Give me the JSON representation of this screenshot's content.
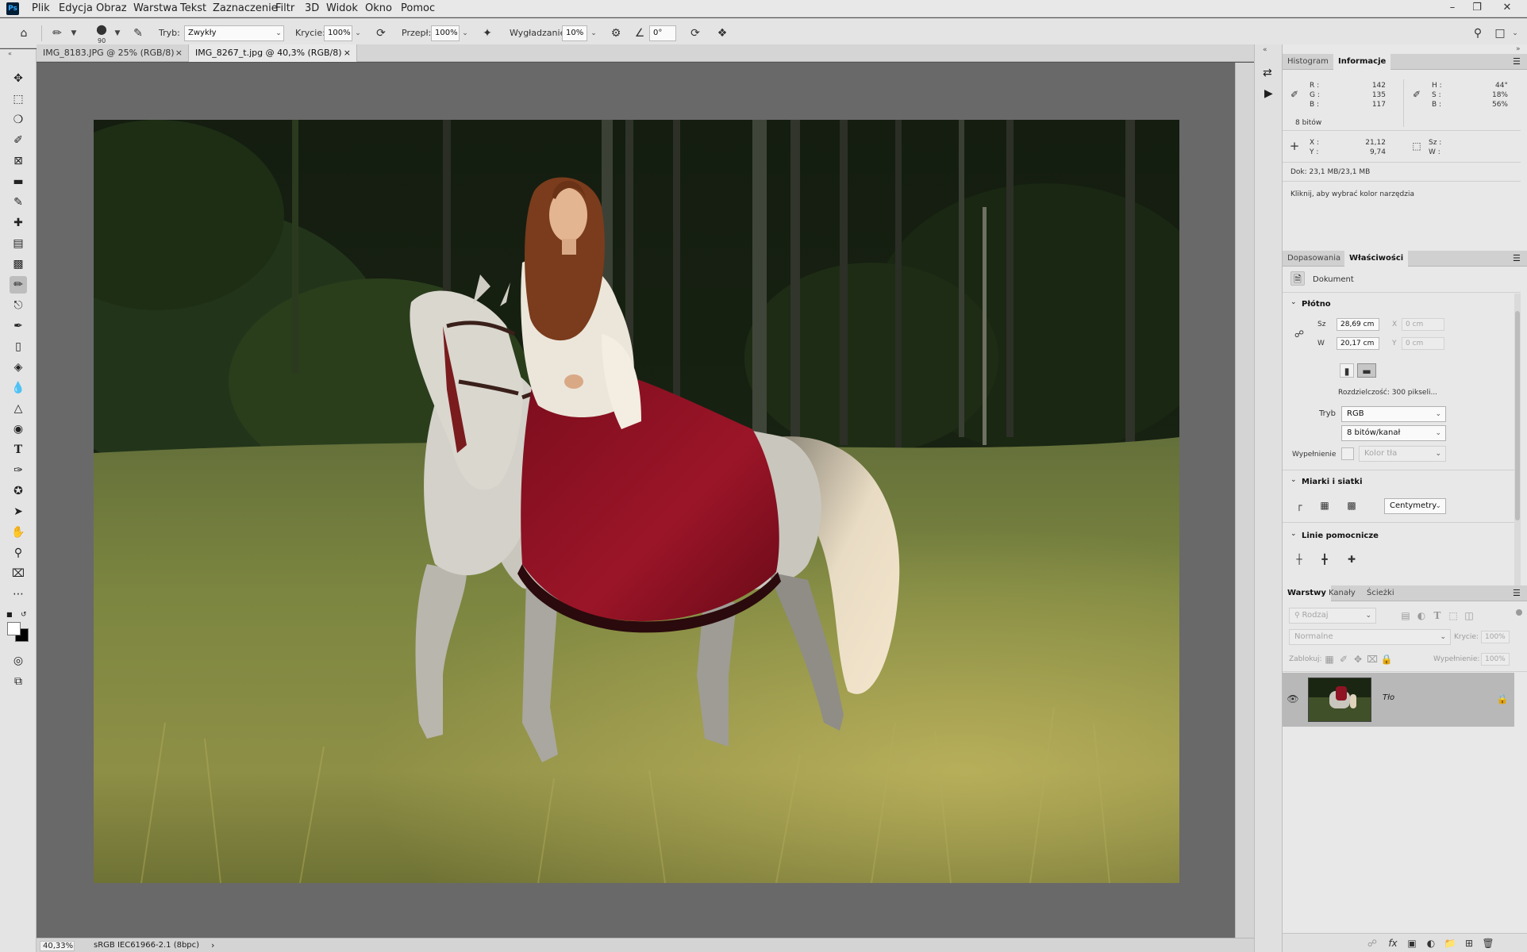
{
  "app": {
    "logo": "Ps"
  },
  "menu": [
    "Plik",
    "Edycja",
    "Obraz",
    "Warstwa",
    "Tekst",
    "Zaznaczenie",
    "Filtr",
    "3D",
    "Widok",
    "Okno",
    "Pomoc"
  ],
  "window_controls": {
    "minimize": "–",
    "restore": "❐",
    "close": "✕"
  },
  "options": {
    "brush_size": "90",
    "mode_label": "Tryb:",
    "mode_value": "Zwykły",
    "opacity_label": "Krycie:",
    "opacity_value": "100%",
    "flow_label": "Przepł:",
    "flow_value": "100%",
    "smoothing_label": "Wygładzanie:",
    "smoothing_value": "10%",
    "angle_value": "0°"
  },
  "tabs": [
    {
      "label": "IMG_8183.JPG @ 25% (RGB/8)",
      "close": "×"
    },
    {
      "label": "IMG_8267_t.jpg @ 40,3% (RGB/8)",
      "close": "×"
    }
  ],
  "status": {
    "zoom": "40,33%",
    "profile": "sRGB IEC61966-2.1 (8bpc)",
    "arrow": "›"
  },
  "info_panel": {
    "tabs": [
      "Histogram",
      "Informacje"
    ],
    "rgb_labels": [
      "R :",
      "G :",
      "B :"
    ],
    "rgb_values": [
      "142",
      "135",
      "117"
    ],
    "hsb_labels": [
      "H :",
      "S :",
      "B :"
    ],
    "hsb_values": [
      "44°",
      "18%",
      "56%"
    ],
    "bits": "8 bitów",
    "xy_labels": [
      "X :",
      "Y :"
    ],
    "xy_values": [
      "21,12",
      "9,74"
    ],
    "wh_labels": [
      "Sz :",
      "W :"
    ],
    "doc": "Dok: 23,1 MB/23,1 MB",
    "hint": "Kliknij, aby wybrać kolor narzędzia"
  },
  "properties_panel": {
    "tabs": [
      "Dopasowania",
      "Właściwości"
    ],
    "doc_label": "Dokument",
    "canvas_title": "Płótno",
    "width_label": "Sz",
    "width_value": "28,69 cm",
    "x_label": "X",
    "x_placeholder": "0 cm",
    "height_label": "W",
    "height_value": "20,17 cm",
    "y_label": "Y",
    "y_placeholder": "0 cm",
    "resolution": "Rozdzielczość:  300  pikseli...",
    "mode_label": "Tryb",
    "mode_value": "RGB",
    "depth_value": "8 bitów/kanał",
    "fill_label": "Wypełnienie",
    "fill_value": "Kolor tła",
    "rulers_title": "Miarki i siatki",
    "units_value": "Centymetry",
    "guides_title": "Linie pomocnicze"
  },
  "layers_panel": {
    "tabs": [
      "Warstwy",
      "Kanały",
      "Ścieżki"
    ],
    "filter_placeholder": "Rodzaj",
    "blend_value": "Normalne",
    "opacity_label": "Krycie:",
    "opacity_value": "100%",
    "lock_label": "Zablokuj:",
    "fill_label": "Wypełnienie:",
    "fill_value": "100%",
    "layer_name": "Tło"
  }
}
